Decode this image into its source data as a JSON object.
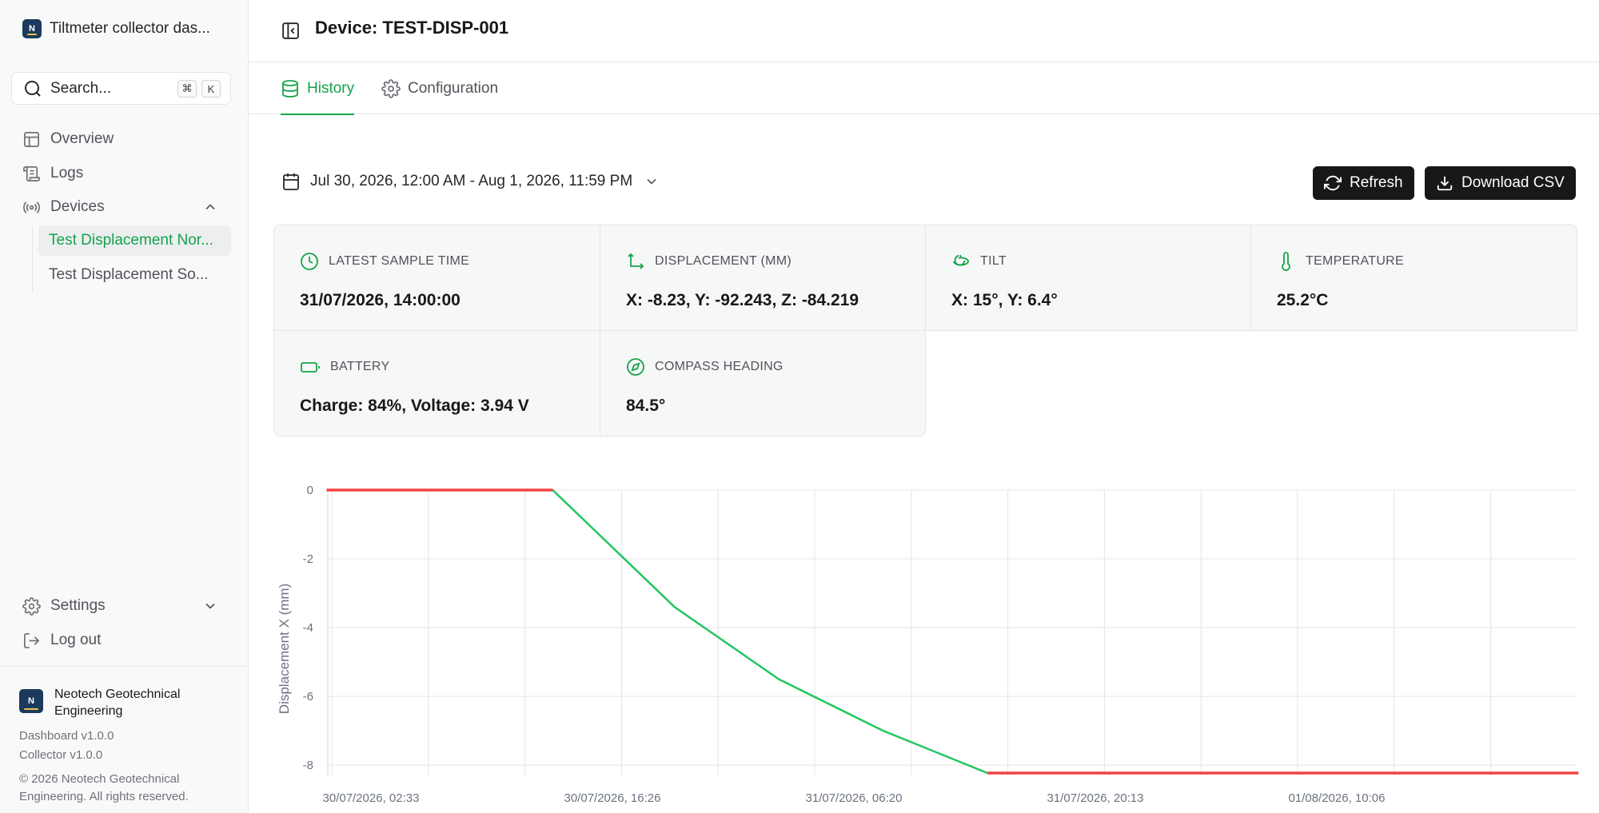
{
  "app": {
    "title": "Tiltmeter collector das..."
  },
  "search": {
    "label": "Search...",
    "shortcut_cmd": "⌘",
    "shortcut_key": "K"
  },
  "nav": {
    "overview": "Overview",
    "logs": "Logs",
    "devices": "Devices",
    "devices_children": [
      "Test Displacement Nor...",
      "Test Displacement So..."
    ],
    "settings": "Settings",
    "logout": "Log out"
  },
  "footer": {
    "logo_letter": "N",
    "org_name": "Neotech Geotechnical Engineering",
    "dashboard_version": "Dashboard v1.0.0",
    "collector_version": "Collector v1.0.0",
    "copyright": "© 2026 Neotech Geotechnical Engineering. All rights reserved."
  },
  "header": {
    "title": "Device: TEST-DISP-001"
  },
  "tabs": [
    {
      "label": "History",
      "active": true
    },
    {
      "label": "Configuration",
      "active": false
    }
  ],
  "date_range": "Jul 30, 2026, 12:00 AM - Aug 1, 2026, 11:59 PM",
  "actions": {
    "refresh": "Refresh",
    "download": "Download CSV"
  },
  "cards": [
    {
      "title": "LATEST SAMPLE TIME",
      "value": "31/07/2026, 14:00:00",
      "icon": "clock-icon"
    },
    {
      "title": "DISPLACEMENT (MM)",
      "value": "X: -8.23, Y: -92.243, Z: -84.219",
      "icon": "axes-icon"
    },
    {
      "title": "TILT",
      "value": "X: 15°, Y: 6.4°",
      "icon": "rotate-icon"
    },
    {
      "title": "TEMPERATURE",
      "value": "25.2°C",
      "icon": "thermometer-icon"
    },
    {
      "title": "BATTERY",
      "value": "Charge: 84%, Voltage: 3.94 V",
      "icon": "battery-icon"
    },
    {
      "title": "COMPASS HEADING",
      "value": "84.5°",
      "icon": "compass-icon"
    }
  ],
  "colors": {
    "accent": "#16a34a",
    "line_ok": "#22c55e",
    "line_flat": "#ef4444"
  },
  "chart_data": {
    "type": "line",
    "ylabel": "Displacement X (mm)",
    "xlabel": "",
    "ylim": [
      -8.3,
      0
    ],
    "yticks": [
      0,
      -2,
      -4,
      -6,
      -8
    ],
    "xticks": [
      "30/07/2026, 02:33",
      "30/07/2026, 16:26",
      "31/07/2026, 06:20",
      "31/07/2026, 20:13",
      "01/08/2026, 10:06"
    ],
    "grid": true,
    "series": [
      {
        "color": "#22c55e",
        "x": [
          "30/07/2026, 00:00",
          "30/07/2026, 13:00",
          "30/07/2026, 20:00",
          "31/07/2026, 02:00",
          "31/07/2026, 08:00",
          "31/07/2026, 14:00"
        ],
        "values": [
          0,
          0,
          -3.4,
          -5.5,
          -7.0,
          -8.23
        ]
      },
      {
        "color": "#ef4444",
        "x": [
          "30/07/2026, 00:00",
          "30/07/2026, 13:00"
        ],
        "values": [
          0,
          0
        ]
      },
      {
        "color": "#ef4444",
        "x": [
          "31/07/2026, 14:00",
          "01/08/2026, 23:59"
        ],
        "values": [
          -8.23,
          -8.23
        ]
      }
    ]
  }
}
